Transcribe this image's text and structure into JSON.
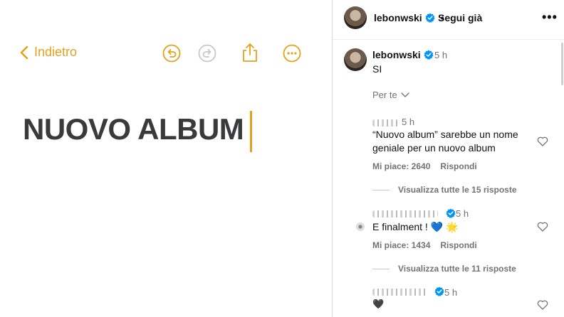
{
  "colors": {
    "notes_accent": "#e3a21a",
    "verified": "#0095f6",
    "muted": "#737373"
  },
  "notes": {
    "back_label": "Indietro",
    "title": "NUOVO ALBUM",
    "toolbar": {
      "undo": "undo-icon",
      "redo": "redo-icon",
      "share": "share-icon",
      "more": "ellipsis-circle-icon"
    }
  },
  "post": {
    "username": "lebonwski",
    "follow_label": "Segui già",
    "dot": "•",
    "more_label": "•••",
    "caption_user": "lebonwski",
    "caption_time": "5 h",
    "caption_text": "SI",
    "sort_label": "Per te"
  },
  "comments": [
    {
      "time": "5 h",
      "text": "“Nuovo album” sarebbe un nome geniale per un nuovo album",
      "likes": "Mi piace: 2640",
      "reply_label": "Rispondi",
      "view_replies": "Visualizza tutte le 15 risposte"
    },
    {
      "time": "5 h",
      "text": "E finalment ! 💙 🌟",
      "likes": "Mi piace: 1434",
      "reply_label": "Rispondi",
      "view_replies": "Visualizza tutte le 11 risposte"
    },
    {
      "time": "5 h",
      "text": "🖤"
    }
  ]
}
